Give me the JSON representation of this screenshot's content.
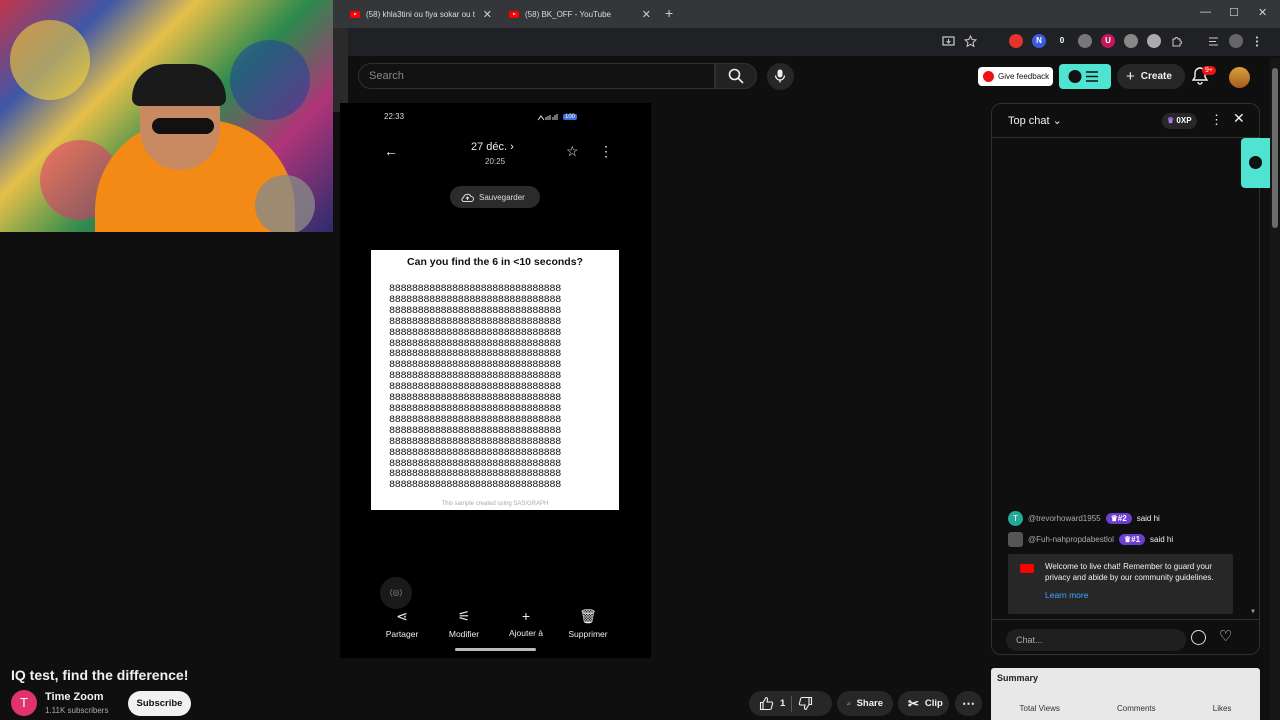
{
  "browser": {
    "tabs": [
      {
        "label": "(58) khla3tini ou fiya sokar ou t"
      },
      {
        "label": "(58) BK_OFF - YouTube"
      }
    ],
    "new_tab": "+",
    "win_min": "—",
    "win_max": "☐",
    "win_close": "✕",
    "extensions": [
      {
        "letter": "",
        "color": "#e3342f"
      },
      {
        "letter": "N",
        "color": "#3b5bdb"
      },
      {
        "letter": "0",
        "color": "#202124"
      },
      {
        "letter": "",
        "color": "#777777"
      },
      {
        "letter": "U",
        "color": "#c2185b"
      },
      {
        "letter": "",
        "color": "#888888"
      },
      {
        "letter": "",
        "color": "#aaaaaa"
      },
      {
        "letter": "",
        "color": "#666666"
      }
    ]
  },
  "header": {
    "search_placeholder": "Search",
    "feedback_label": "Give feedback",
    "create_label": "Create",
    "notif_badge": "9+"
  },
  "phone": {
    "status_time": "22:33",
    "battery": "100",
    "date": "27 déc. ›",
    "time": "20:25",
    "save_label": "Sauvegarder",
    "card_title": "Can you find the 6 in <10 seconds?",
    "grid_lines": [
      "888888888888888888888888888888",
      "888888888888888888888888888888",
      "888888888888888888888888888888",
      "888888888888888888888888888888",
      "888888888888888888888888888888",
      "888888888888888888888888888888",
      "888888888888888888888888888888",
      "888888888888888888888888888888",
      "888888888888888888888888888888",
      "888888888888888888888888888888",
      "888888888888888888888888888888",
      "888888888888888888888888888888",
      "888888888888888888888888888888",
      "888888888888888888888888888888",
      "888888888888888888888888888888",
      "888888888888888888888888888888",
      "888888888888888888888888888888",
      "888888888888888888888888888888",
      "888888888888888888888888888888"
    ],
    "card_footer": "This sample created using SAS/GRAPH",
    "bubble": "(◎)",
    "actions": {
      "share": "Partager",
      "edit": "Modifier",
      "add": "Ajouter à",
      "delete": "Supprimer"
    }
  },
  "chat": {
    "title": "Top chat",
    "xp": "0XP",
    "messages": [
      {
        "avatar": "T",
        "user": "@trevorhoward1955",
        "rank": "#2",
        "text": "said hi"
      },
      {
        "avatar": "",
        "user": "@Fuh-nahpropdabestlol",
        "rank": "#1",
        "text": "said hi"
      }
    ],
    "welcome_text": "Welcome to live chat! Remember to guard your privacy and abide by our community guidelines.",
    "learn_more": "Learn more",
    "input_placeholder": "Chat..."
  },
  "summary": {
    "title": "Summary",
    "cols": [
      "Total Views",
      "Comments",
      "Likes"
    ]
  },
  "video": {
    "title": "IQ test, find the difference!",
    "channel_initial": "T",
    "channel": "Time Zoom",
    "subscribers": "1.11K subscribers",
    "subscribe": "Subscribe",
    "likes": "1",
    "share": "Share",
    "clip": "Clip"
  }
}
